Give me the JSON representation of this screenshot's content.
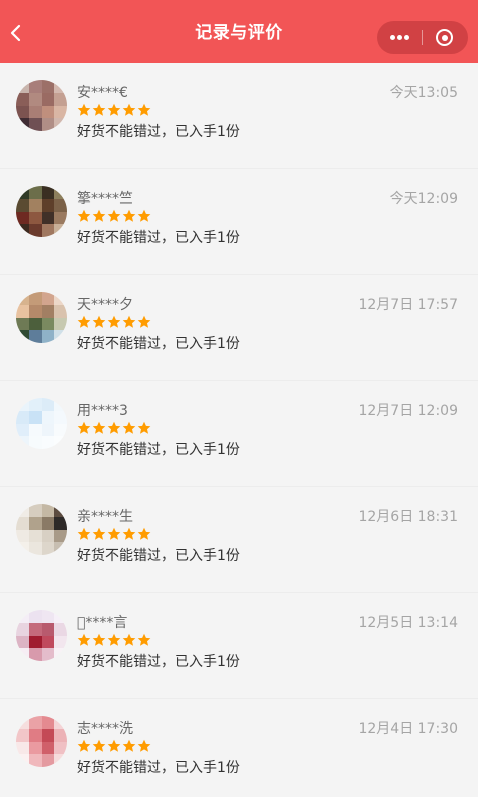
{
  "navbar": {
    "title": "记录与评价",
    "background_color": "#f25556",
    "back_icon": "chevron-left-icon",
    "more_icon": "more-dots-icon",
    "close_icon": "target-circle-icon"
  },
  "colors": {
    "star": "#ff9c00",
    "page_background": "#f4f4f4",
    "time_text": "#a5a5a5"
  },
  "reviews": [
    {
      "username": "安****€",
      "time": "今天13:05",
      "rating": 5,
      "text": "好货不能错过，已入手1份",
      "avatar_pixels": [
        "#c8b4ac",
        "#a87e7a",
        "#9c7068",
        "#d3b8ae",
        "#8a5e58",
        "#b18a80",
        "#9a6b63",
        "#c4a092",
        "#7c5350",
        "#a97e75",
        "#c08f7d",
        "#d9b6a4",
        "#3f2c33",
        "#6f5054",
        "#b08e86",
        "#d1b7ad"
      ]
    },
    {
      "username": "篫****竺",
      "time": "今天12:09",
      "rating": 5,
      "text": "好货不能错过，已入手1份",
      "avatar_pixels": [
        "#2f3a26",
        "#6c6e4a",
        "#3a2f22",
        "#8d7f5c",
        "#5a4b32",
        "#a28160",
        "#5e3f2a",
        "#7b6148",
        "#6e2a22",
        "#8d5840",
        "#403028",
        "#9a7a60",
        "#3d2a20",
        "#6b3b2d",
        "#a07860",
        "#c8b098"
      ]
    },
    {
      "username": "天****夕",
      "time": "12月7日 17:57",
      "rating": 5,
      "text": "好货不能错过，已入手1份",
      "avatar_pixels": [
        "#d7b38e",
        "#c49b78",
        "#d2a58e",
        "#ecd7c8",
        "#e8c2a0",
        "#b58a6a",
        "#a27f63",
        "#d9c2ad",
        "#6e7a55",
        "#4c5f3c",
        "#7a8a60",
        "#c7c9b0",
        "#2f4a33",
        "#5e7d9a",
        "#8fb2c8",
        "#d0e0e8"
      ]
    },
    {
      "username": "用****3",
      "time": "12月7日 12:09",
      "rating": 5,
      "text": "好货不能错过，已入手1份",
      "avatar_pixels": [
        "#eaf4fb",
        "#e2f0fa",
        "#dcecf8",
        "#f2f8fc",
        "#d8eaf8",
        "#c9e2f6",
        "#eef6fc",
        "#f4f9fd",
        "#e0eefa",
        "#f6fafd",
        "#eef5fb",
        "#f8fbfd",
        "#edf5fb",
        "#f7fbfd",
        "#f9fcfe",
        "#fbfdfe"
      ]
    },
    {
      "username": "亲****生",
      "time": "12月6日 18:31",
      "rating": 5,
      "text": "好货不能错过，已入手1份",
      "avatar_pixels": [
        "#f0ece6",
        "#d6cdbf",
        "#c4b8a4",
        "#5c4c40",
        "#e4ddd2",
        "#b0a28c",
        "#8a7a66",
        "#2e2a28",
        "#efeae3",
        "#e6e0d6",
        "#d8d0c4",
        "#a89a88",
        "#f4f0ea",
        "#ebe6de",
        "#ddd6cb",
        "#c7beb1"
      ]
    },
    {
      "username": "\u0000****言",
      "time": "12月5日 13:14",
      "rating": 5,
      "text": "好货不能错过，已入手1份",
      "avatar_pixels": [
        "#f4eef6",
        "#ece2f0",
        "#efe6f2",
        "#f6f0f8",
        "#e8d4e0",
        "#c46a7c",
        "#b85a6e",
        "#ead8e4",
        "#dcb4c4",
        "#a01c30",
        "#c04a5e",
        "#f2e6ee",
        "#f6eef4",
        "#d89aac",
        "#e4bccb",
        "#f8f2f6"
      ]
    },
    {
      "username": "志****洗",
      "time": "12月4日 17:30",
      "rating": 5,
      "text": "好货不能错过，已入手1份",
      "avatar_pixels": [
        "#f6dede",
        "#eaa2a6",
        "#e48a90",
        "#f4d4d6",
        "#f2c6c8",
        "#e07c84",
        "#c44a56",
        "#ecb2b6",
        "#f8e8e8",
        "#ea9aa0",
        "#d0606a",
        "#f0c0c4",
        "#fbf1f1",
        "#f0b8bc",
        "#e49aa0",
        "#f6dcdc"
      ]
    }
  ]
}
